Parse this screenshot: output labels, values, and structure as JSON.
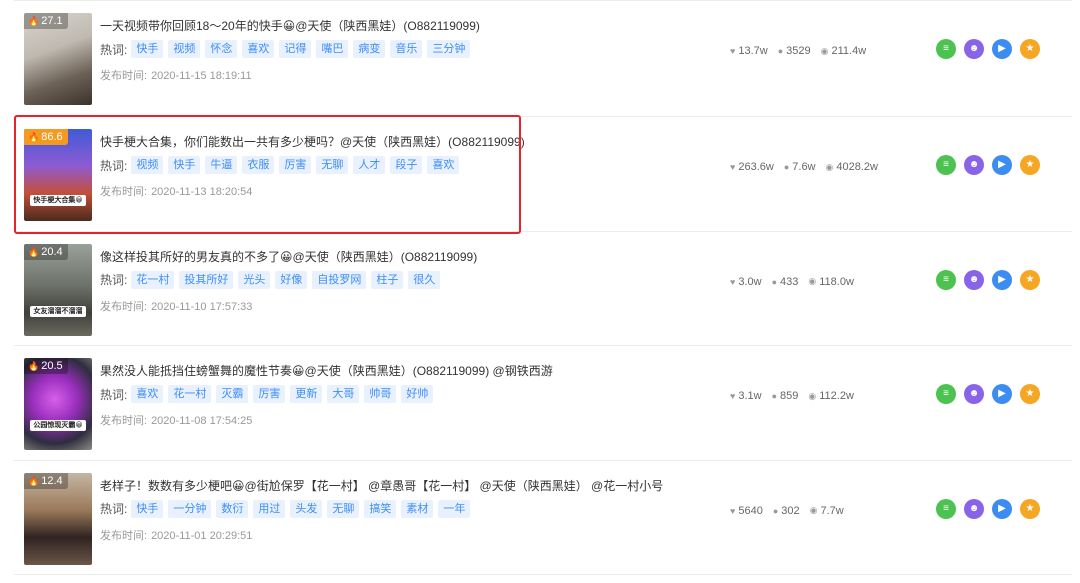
{
  "labels": {
    "hot_words": "热词:",
    "publish_prefix": "发布时间:"
  },
  "icons": {
    "heat": "flame-icon",
    "likes": "heart-icon",
    "comments": "comment-icon",
    "views": "eye-icon",
    "detail": "list-icon",
    "fans": "people-icon",
    "play": "play-icon",
    "favorite": "star-icon"
  },
  "colors": {
    "tag_bg": "#e8f1fd",
    "tag_text": "#3e8ef7",
    "heat_hot": "#f39a20",
    "highlight": "#e8212b",
    "act_green": "#4cc251",
    "act_purple": "#8a64e8",
    "act_blue": "#3d8cf2",
    "act_orange": "#f5a623"
  },
  "items": [
    {
      "heat": "27.1",
      "title": "一天视频带你回顾18～20年的快手😀@天使（陕西黑娃）(O882119099)",
      "tags": [
        "快手",
        "视频",
        "怀念",
        "喜欢",
        "记得",
        "嘴巴",
        "病变",
        "音乐",
        "三分钟"
      ],
      "date": "2020-11-15 18:19:11",
      "likes": "13.7w",
      "comments": "3529",
      "views": "211.4w",
      "thumb_text": ""
    },
    {
      "heat": "86.6",
      "title": "快手梗大合集，你们能数出一共有多少梗吗？@天使（陕西黑娃）(O882119099)",
      "tags": [
        "视频",
        "快手",
        "牛逼",
        "衣服",
        "厉害",
        "无聊",
        "人才",
        "段子",
        "喜欢"
      ],
      "date": "2020-11-13 18:20:54",
      "likes": "263.6w",
      "comments": "7.6w",
      "views": "4028.2w",
      "thumb_text": "快手梗大合集😀"
    },
    {
      "heat": "20.4",
      "title": "像这样投其所好的男友真的不多了😀@天使（陕西黑娃）(O882119099)",
      "tags": [
        "花一村",
        "投其所好",
        "光头",
        "好像",
        "自投罗网",
        "柱子",
        "很久"
      ],
      "date": "2020-11-10 17:57:33",
      "likes": "3.0w",
      "comments": "433",
      "views": "118.0w",
      "thumb_text": "女友溜溜不溜溜"
    },
    {
      "heat": "20.5",
      "title": "果然没人能抵挡住螃蟹舞的魔性节奏😀@天使（陕西黑娃）(O882119099) @钢铁西游",
      "tags": [
        "喜欢",
        "花一村",
        "灭霸",
        "厉害",
        "更新",
        "大哥",
        "帅哥",
        "好帅"
      ],
      "date": "2020-11-08 17:54:25",
      "likes": "3.1w",
      "comments": "859",
      "views": "112.2w",
      "thumb_text": "公园惊现灭霸😀"
    },
    {
      "heat": "12.4",
      "title": "老样子！数数有多少梗吧😀@街尬保罗【花一村】 @章愚哥【花一村】 @天使（陕西黑娃） @花一村小号",
      "tags": [
        "快手",
        "一分钟",
        "数衍",
        "用过",
        "头发",
        "无聊",
        "搞笑",
        "素材",
        "一年"
      ],
      "date": "2020-11-01 20:29:51",
      "likes": "5640",
      "comments": "302",
      "views": "7.7w",
      "thumb_text": ""
    }
  ]
}
